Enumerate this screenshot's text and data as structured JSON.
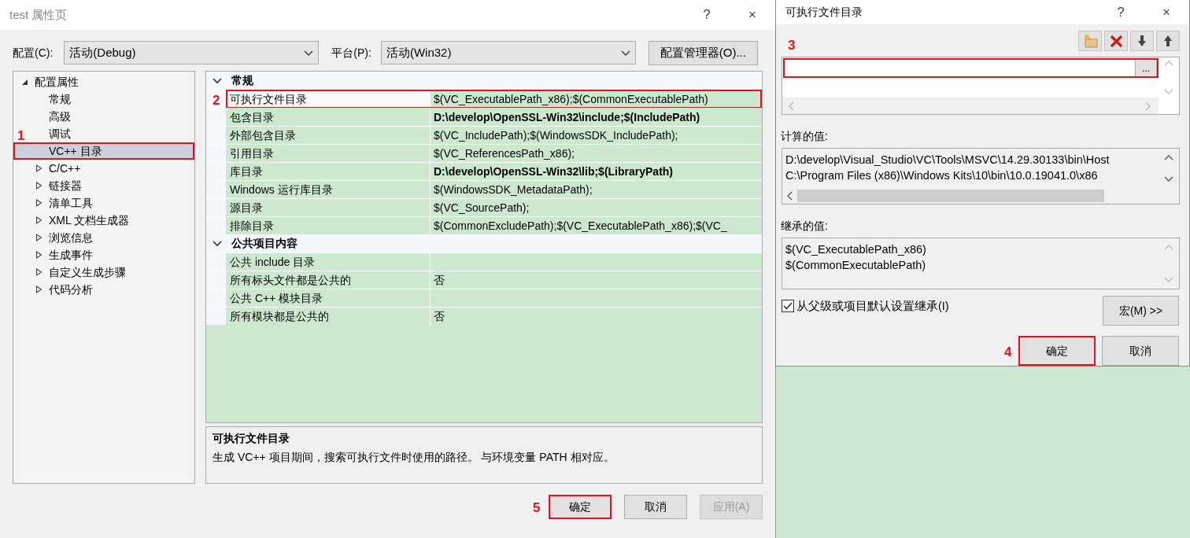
{
  "main_dialog": {
    "title": "test 属性页",
    "help": "?",
    "close": "×",
    "config_label": "配置(C):",
    "config_value": "活动(Debug)",
    "platform_label": "平台(P):",
    "platform_value": "活动(Win32)",
    "config_manager_button": "配置管理器(O)...",
    "tree": [
      {
        "label": "配置属性",
        "kind": "branch",
        "expanded": true,
        "selected": false,
        "children": [
          {
            "label": "常规",
            "kind": "leaf",
            "selected": false
          },
          {
            "label": "高级",
            "kind": "leaf",
            "selected": false
          },
          {
            "label": "调试",
            "kind": "leaf",
            "selected": false
          },
          {
            "label": "VC++ 目录",
            "kind": "leaf",
            "selected": true,
            "marker": "1"
          },
          {
            "label": "C/C++",
            "kind": "branch",
            "expanded": false,
            "selected": false
          },
          {
            "label": "链接器",
            "kind": "branch",
            "expanded": false,
            "selected": false
          },
          {
            "label": "清单工具",
            "kind": "branch",
            "expanded": false,
            "selected": false
          },
          {
            "label": "XML 文档生成器",
            "kind": "branch",
            "expanded": false,
            "selected": false
          },
          {
            "label": "浏览信息",
            "kind": "branch",
            "expanded": false,
            "selected": false
          },
          {
            "label": "生成事件",
            "kind": "branch",
            "expanded": false,
            "selected": false
          },
          {
            "label": "自定义生成步骤",
            "kind": "branch",
            "expanded": false,
            "selected": false
          },
          {
            "label": "代码分析",
            "kind": "branch",
            "expanded": false,
            "selected": false
          }
        ]
      }
    ],
    "property_grid": [
      {
        "label": "常规",
        "expanded": true,
        "rows": [
          {
            "name": "可执行文件目录",
            "value": "$(VC_ExecutablePath_x86);$(CommonExecutablePath)",
            "bold": false,
            "selected": true,
            "marker": "2"
          },
          {
            "name": "包含目录",
            "value": "D:\\develop\\OpenSSL-Win32\\include;$(IncludePath)",
            "bold": true,
            "selected": false
          },
          {
            "name": "外部包含目录",
            "value": "$(VC_IncludePath);$(WindowsSDK_IncludePath);",
            "bold": false,
            "selected": false
          },
          {
            "name": "引用目录",
            "value": "$(VC_ReferencesPath_x86);",
            "bold": false,
            "selected": false
          },
          {
            "name": "库目录",
            "value": "D:\\develop\\OpenSSL-Win32\\lib;$(LibraryPath)",
            "bold": true,
            "selected": false
          },
          {
            "name": "Windows 运行库目录",
            "value": "$(WindowsSDK_MetadataPath);",
            "bold": false,
            "selected": false
          },
          {
            "name": "源目录",
            "value": "$(VC_SourcePath);",
            "bold": false,
            "selected": false
          },
          {
            "name": "排除目录",
            "value": "$(CommonExcludePath);$(VC_ExecutablePath_x86);$(VC_",
            "bold": false,
            "selected": false
          }
        ]
      },
      {
        "label": "公共项目内容",
        "expanded": true,
        "rows": [
          {
            "name": "公共 include 目录",
            "bold": false,
            "selected": false
          },
          {
            "name": "所有标头文件都是公共的",
            "value": "否",
            "bold": false,
            "selected": false
          },
          {
            "name": "公共 C++ 模块目录",
            "bold": false,
            "selected": false
          },
          {
            "name": "所有模块都是公共的",
            "value": "否",
            "bold": false,
            "selected": false
          }
        ]
      }
    ],
    "description": {
      "title": "可执行文件目录",
      "text": "生成 VC++ 项目期间，搜索可执行文件时使用的路径。 与环境变量 PATH 相对应。"
    },
    "buttons": [
      {
        "label": "确定",
        "disabled": false,
        "marker": "5"
      },
      {
        "label": "取消",
        "disabled": false
      },
      {
        "label": "应用(A)",
        "disabled": true
      }
    ]
  },
  "edit_dialog": {
    "title": "可执行文件目录",
    "help": "?",
    "close": "×",
    "marker": "3",
    "browse_button": "...",
    "computed_label": "计算的值:",
    "computed_values": [
      "D:\\develop\\Visual_Studio\\VC\\Tools\\MSVC\\14.29.30133\\bin\\Host",
      "C:\\Program Files (x86)\\Windows Kits\\10\\bin\\10.0.19041.0\\x86"
    ],
    "inherited_label": "继承的值:",
    "inherited_values": [
      "$(VC_ExecutablePath_x86)",
      "$(CommonExecutablePath)"
    ],
    "inherit_checkbox": {
      "label": "从父级或项目默认设置继承(I)",
      "checked": true
    },
    "macros_button": "宏(M) >>",
    "buttons": [
      {
        "label": "确定",
        "marker": "4"
      },
      {
        "label": "取消"
      }
    ]
  }
}
